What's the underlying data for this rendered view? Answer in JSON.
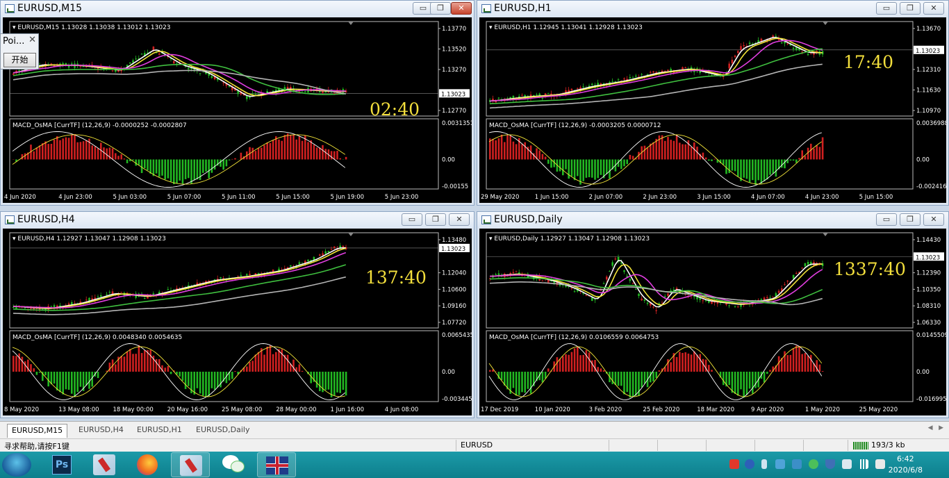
{
  "windows": [
    {
      "id": "m15",
      "title": "EURUSD,M15",
      "header": "EURUSD,M15  1.13028 1.13038 1.13012 1.13023",
      "price_ticks": [
        "1.13770",
        "1.13520",
        "1.13270",
        "1.13023",
        "1.12770"
      ],
      "macd_label": "MACD_OsMA [CurrTF] (12,26,9) -0.0000252 -0.0002807",
      "macd_ticks": [
        "0.0031351",
        "0.00",
        "-0.00155"
      ],
      "time_ticks": [
        "4 Jun 2020",
        "4 Jun 23:00",
        "5 Jun 03:00",
        "5 Jun 07:00",
        "5 Jun 11:00",
        "5 Jun 15:00",
        "5 Jun 19:00",
        "5 Jun 23:00"
      ],
      "clock": "02:40"
    },
    {
      "id": "h1",
      "title": "EURUSD,H1",
      "header": "EURUSD,H1  1.12945 1.13041 1.12928 1.13023",
      "price_ticks": [
        "1.13670",
        "1.13023",
        "1.12310",
        "1.11630",
        "1.10970"
      ],
      "macd_label": "MACD_OsMA [CurrTF] (12,26,9) -0.0003205 0.0000712",
      "macd_ticks": [
        "0.0036988",
        "0.00",
        "-0.0024167"
      ],
      "time_ticks": [
        "29 May 2020",
        "1 Jun 15:00",
        "2 Jun 07:00",
        "2 Jun 23:00",
        "3 Jun 15:00",
        "4 Jun 07:00",
        "4 Jun 23:00",
        "5 Jun 15:00"
      ],
      "clock": "17:40"
    },
    {
      "id": "h4",
      "title": "EURUSD,H4",
      "header": "EURUSD,H4  1.12927 1.13047 1.12908 1.13023",
      "price_ticks": [
        "1.13480",
        "1.13023",
        "1.12040",
        "1.10600",
        "1.09160",
        "1.07720"
      ],
      "macd_label": "MACD_OsMA [CurrTF] (12,26,9) 0.0048340 0.0054635",
      "macd_ticks": [
        "0.0065435",
        "0.00",
        "-0.003445"
      ],
      "time_ticks": [
        "8 May 2020",
        "13 May 08:00",
        "18 May 00:00",
        "20 May 16:00",
        "25 May 08:00",
        "28 May 00:00",
        "1 Jun 16:00",
        "4 Jun 08:00"
      ],
      "clock": "137:40"
    },
    {
      "id": "d1",
      "title": "EURUSD,Daily",
      "header": "EURUSD,Daily  1.12927 1.13047 1.12908 1.13023",
      "price_ticks": [
        "1.14430",
        "1.13023",
        "1.12390",
        "1.10350",
        "1.08310",
        "1.06330"
      ],
      "macd_label": "MACD_OsMA [CurrTF] (12,26,9) 0.0106559 0.0064753",
      "macd_ticks": [
        "0.0145509",
        "0.00",
        "-0.016995"
      ],
      "time_ticks": [
        "17 Dec 2019",
        "10 Jan 2020",
        "3 Feb 2020",
        "25 Feb 2020",
        "18 Mar 2020",
        "9 Apr 2020",
        "1 May 2020",
        "25 May 2020"
      ],
      "clock": "1337:40"
    }
  ],
  "window_buttons": {
    "minimize": "▭",
    "restore": "❐",
    "close": "✕"
  },
  "dialog": {
    "title": "Poi...",
    "close": "✕",
    "start_button": "开始"
  },
  "tabs": [
    "EURUSD,M15",
    "EURUSD,H4",
    "EURUSD,H1",
    "EURUSD,Daily"
  ],
  "active_tab": "EURUSD,M15",
  "status": {
    "help": "寻求帮助,请按F1键",
    "symbol": "EURUSD",
    "traffic": "193/3 kb"
  },
  "taskbar": {
    "time": "6:42",
    "date": "2020/6/8",
    "icons": [
      "start-orb",
      "photoshop",
      "metatrader",
      "firefox",
      "metatrader-2",
      "wechat",
      "uk-flag"
    ]
  },
  "colors": {
    "bg": "#000000",
    "bull": "#22b822",
    "bear": "#d02020",
    "ma_white": "#ffffff",
    "ma_yellow": "#f2e438",
    "ma_magenta": "#e13ee0",
    "ma_green": "#3fbf3f",
    "ma_gray": "#b4b4b4",
    "clock": "#f3df3c"
  }
}
